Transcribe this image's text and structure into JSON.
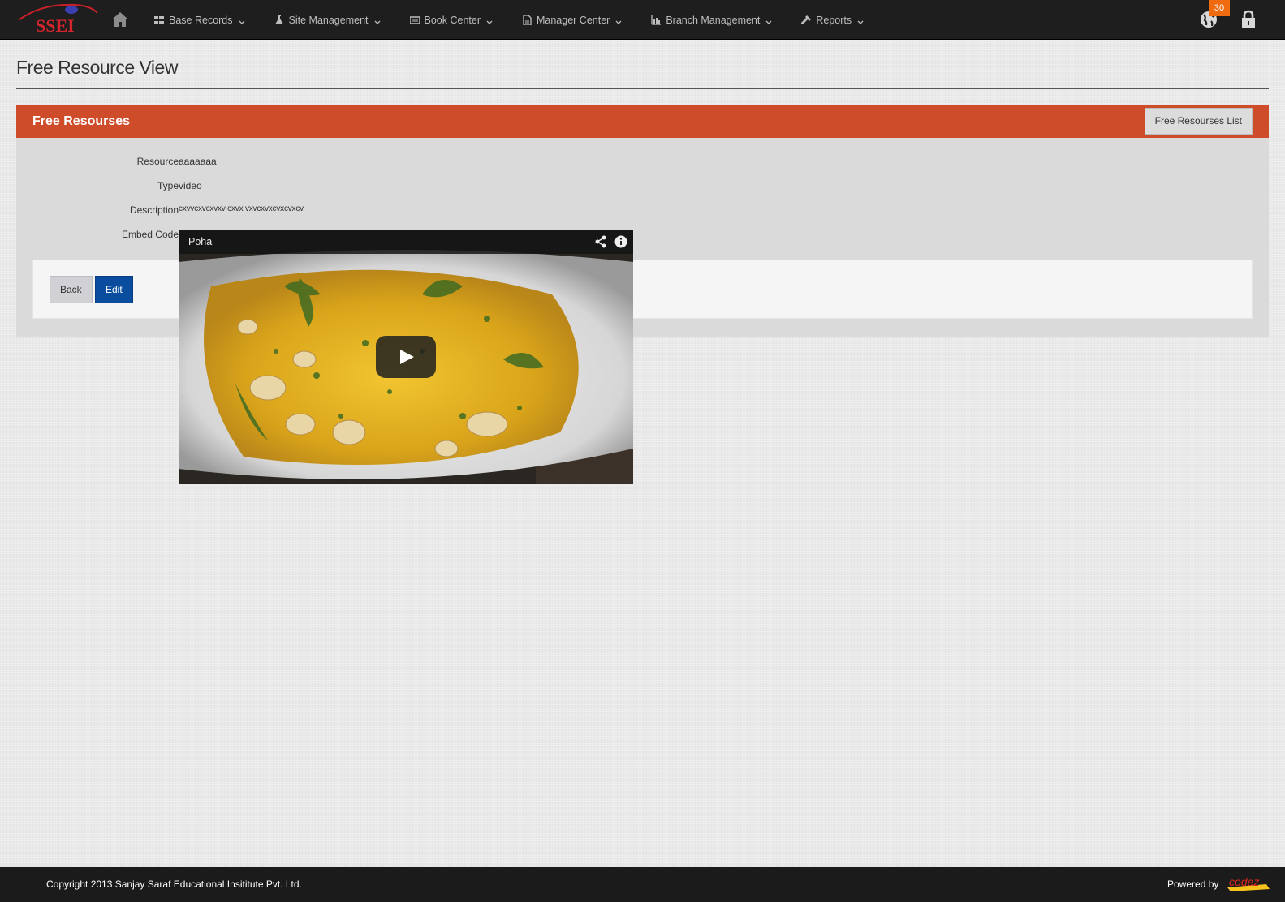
{
  "nav": {
    "brand": "SSEI",
    "items": [
      {
        "label": "Base Records",
        "icon": "grid-icon"
      },
      {
        "label": "Site Management",
        "icon": "flask-icon"
      },
      {
        "label": "Book Center",
        "icon": "book-icon"
      },
      {
        "label": "Manager Center",
        "icon": "document-icon"
      },
      {
        "label": "Branch Management",
        "icon": "bar-chart-icon"
      },
      {
        "label": "Reports",
        "icon": "wrench-icon"
      }
    ],
    "notification_count": "30"
  },
  "page": {
    "title": "Free Resource View"
  },
  "panel": {
    "title": "Free Resourses",
    "list_button": "Free Resourses List",
    "fields": {
      "resource_label": "Resource",
      "resource_value": "aaaaaaa",
      "type_label": "Type",
      "type_value": "video",
      "description_label": "Description",
      "description_value": "cxvvcxvcxvxv cxvx vxvcxvxcvxcvxcv",
      "embed_label": "Embed Code"
    },
    "actions": {
      "back": "Back",
      "edit": "Edit"
    }
  },
  "video": {
    "title": "Poha"
  },
  "footer": {
    "copyright": "Copyright 2013 Sanjay Saraf Educational Insititute Pvt. Ltd.",
    "powered_by": "Powered by",
    "powered_logo": "codez"
  },
  "colors": {
    "navbar": "#1e1e1e",
    "panel_header": "#cf4c2b",
    "badge": "#f06a0f",
    "edit_button": "#0a4d9e"
  }
}
